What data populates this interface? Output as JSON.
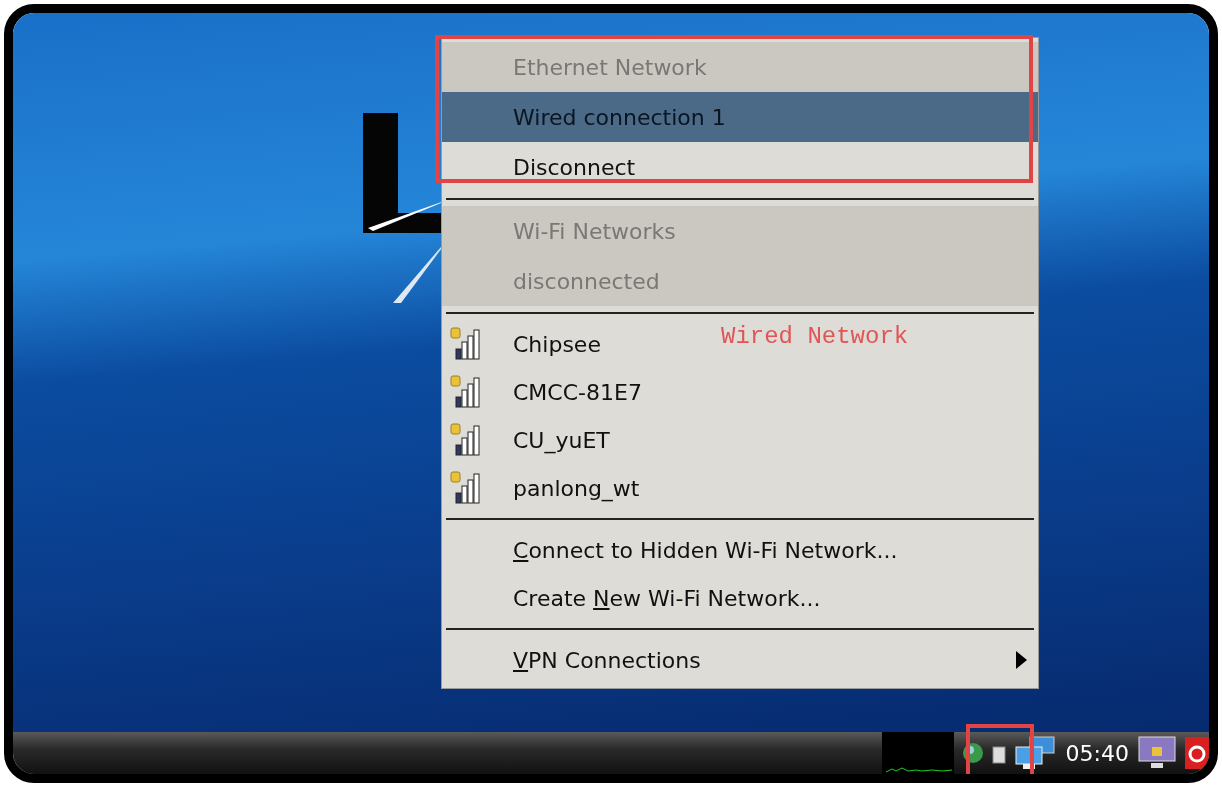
{
  "menu": {
    "items": [
      {
        "kind": "header",
        "label": "Ethernet Network"
      },
      {
        "kind": "item",
        "label": "Wired connection 1",
        "selected": true
      },
      {
        "kind": "item",
        "label": "Disconnect",
        "selected": false
      },
      {
        "kind": "separator"
      },
      {
        "kind": "header",
        "label": "Wi-Fi Networks"
      },
      {
        "kind": "header",
        "label": "disconnected"
      },
      {
        "kind": "separator"
      },
      {
        "kind": "network",
        "label": "Chipsee",
        "selected": false
      },
      {
        "kind": "network",
        "label": "CMCC-81E7",
        "selected": false
      },
      {
        "kind": "network",
        "label": "CU_yuET",
        "selected": false
      },
      {
        "kind": "network",
        "label": "panlong_wt",
        "selected": false
      },
      {
        "kind": "separator"
      },
      {
        "kind": "action",
        "key": "C",
        "after": "onnect to Hidden Wi-Fi Network..."
      },
      {
        "kind": "action",
        "before": "Create ",
        "key": "N",
        "after": "ew Wi-Fi Network..."
      },
      {
        "kind": "separator"
      },
      {
        "kind": "submenu",
        "key": "V",
        "after": "PN Connections"
      }
    ]
  },
  "annotation": {
    "text": "Wired Network"
  },
  "taskbar": {
    "clock": "05:40"
  }
}
